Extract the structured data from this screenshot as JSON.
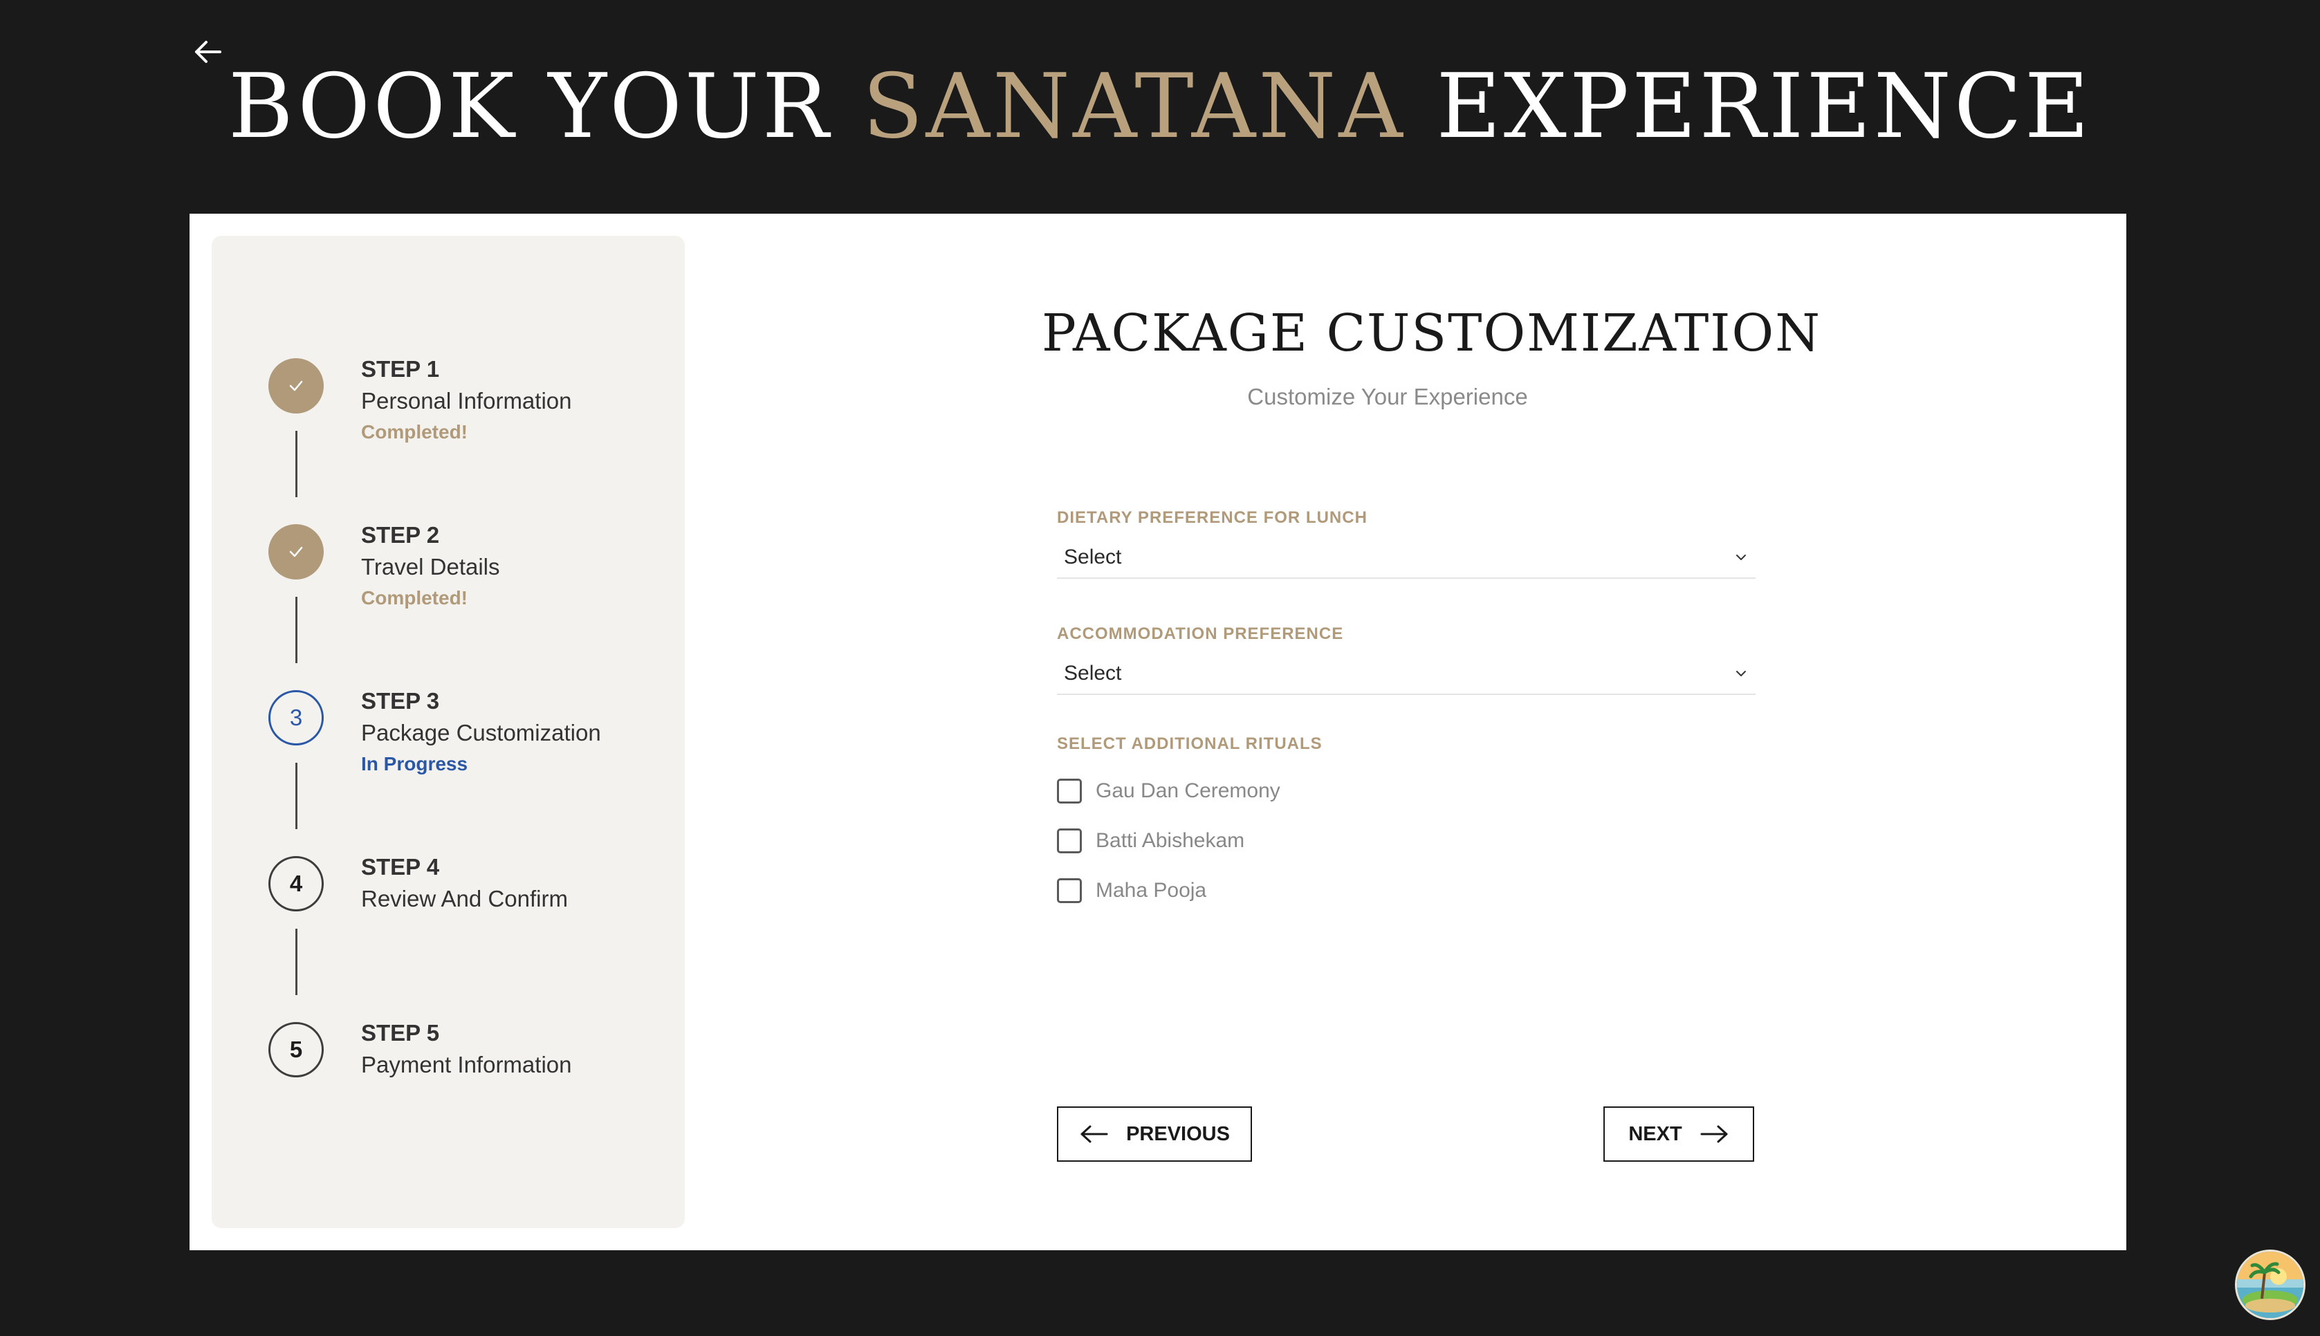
{
  "header": {
    "title_part1": "BOOK YOUR",
    "title_accent": "SANATANA",
    "title_part2": "EXPERIENCE",
    "back_icon": "arrow-left-icon"
  },
  "colors": {
    "background": "#1a1a1a",
    "accent": "#b9a17e",
    "in_progress": "#2a57a6"
  },
  "stepper": {
    "steps": [
      {
        "label": "STEP 1",
        "title": "Personal Information",
        "status": "Completed!",
        "state": "done"
      },
      {
        "label": "STEP 2",
        "title": "Travel Details",
        "status": "Completed!",
        "state": "done"
      },
      {
        "label": "STEP 3",
        "number": "3",
        "title": "Package Customization",
        "status": "In Progress",
        "state": "active"
      },
      {
        "label": "STEP 4",
        "number": "4",
        "title": "Review And Confirm",
        "status": "",
        "state": "pending"
      },
      {
        "label": "STEP 5",
        "number": "5",
        "title": "Payment Information",
        "status": "",
        "state": "pending"
      }
    ]
  },
  "form": {
    "title": "PACKAGE CUSTOMIZATION",
    "subtitle": "Customize Your Experience",
    "dietary": {
      "label": "DIETARY PREFERENCE FOR LUNCH",
      "value": "Select"
    },
    "accommodation": {
      "label": "ACCOMMODATION PREFERENCE",
      "value": "Select"
    },
    "rituals": {
      "label": "SELECT ADDITIONAL RITUALS",
      "options": [
        {
          "label": "Gau Dan Ceremony",
          "checked": false
        },
        {
          "label": "Batti Abishekam",
          "checked": false
        },
        {
          "label": "Maha Pooja",
          "checked": false
        }
      ]
    },
    "previous_label": "PREVIOUS",
    "next_label": "NEXT"
  },
  "fab": {
    "icon": "island-logo-icon"
  }
}
